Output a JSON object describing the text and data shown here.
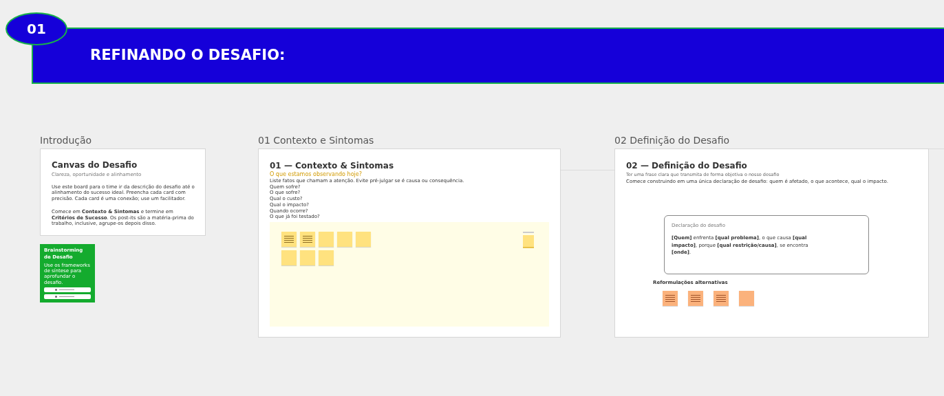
{
  "header": {
    "badge": "01",
    "title": "REFINANDO O DESAFIO:"
  },
  "intro": {
    "label": "Introdução",
    "title": "Canvas do Desafio",
    "subtitle": "Clareza, oportunidade e alinhamento",
    "body": "Use este board para o time ir da descrição do desafio até o alinhamento do sucesso ideal. Preencha cada card com precisão. Cada card é uma conexão; use um facilitador.",
    "footer": "Comece em **Contexto & Sintomas** e termine em **Critérios de Sucesso**. Os post-its são a matéria-prima do trabalho, inclusive, agrupe-os depois disso."
  },
  "brainstorm": {
    "title": "Brainstorming de Desafio",
    "body": "Use os frameworks de síntese para aprofundar o desafio."
  },
  "context": {
    "label": "01 Contexto e Sintomas",
    "title": "01 — Contexto & Sintomas",
    "question": "O que estamos observando hoje?",
    "description": "Liste fatos que chamam a atenção. Evite pré-julgar se é causa ou consequência.",
    "prompts": [
      "Quem sofre?",
      "O que sofre?",
      "Qual o custo?",
      "Qual o impacto?",
      "Quando ocorre?",
      "O que já foi testado?"
    ],
    "notes": [
      {
        "kind": "lines"
      },
      {
        "kind": "lines"
      },
      {
        "kind": "blank"
      },
      {
        "kind": "blank"
      },
      {
        "kind": "blank"
      },
      {
        "kind": "blank"
      },
      {
        "kind": "blank"
      },
      {
        "kind": "blank"
      }
    ]
  },
  "definition": {
    "label": "02 Definição do Desafio",
    "title": "02 — Definição do Desafio",
    "subtitle": "Ter uma frase clara que transmita de forma objetiva o nosso desafio",
    "description": "Comece construindo em uma única declaração de desafio: quem é afetado, o que acontece, qual o impacto.",
    "statement_label": "Declaração do desafio",
    "statement": "**[Quem]** enfrenta **[qual problema]**, o que causa **[qual impacto]**, porque **[qual restrição/causa]**, se encontra **[onde]**.",
    "alternatives_label": "Reformulações alternativas",
    "notes": [
      {
        "kind": "lines"
      },
      {
        "kind": "lines"
      },
      {
        "kind": "lines"
      },
      {
        "kind": "blank"
      }
    ]
  }
}
